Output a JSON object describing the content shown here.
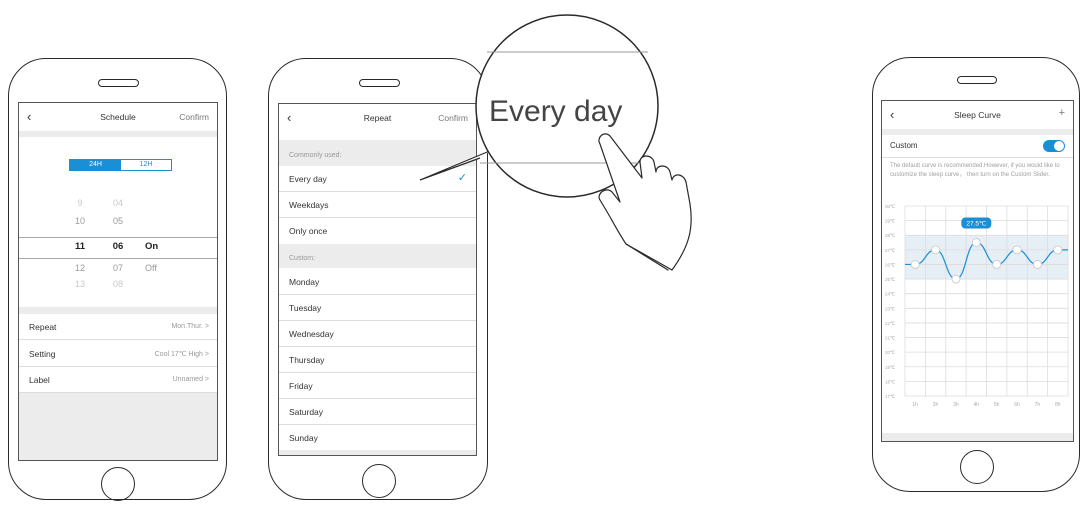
{
  "accent": "#1a8fd6",
  "phone1": {
    "back_icon": "chevron-left-icon",
    "title": "Schedule",
    "confirm": "Confirm",
    "format_24": "24H",
    "format_12": "12H",
    "hours": [
      "9",
      "10",
      "11",
      "12",
      "13"
    ],
    "minutes": [
      "04",
      "05",
      "06",
      "07",
      "08"
    ],
    "modes": [
      "On",
      "Off"
    ],
    "rows": [
      {
        "label": "Repeat",
        "value": "Mon.Thur. >"
      },
      {
        "label": "Setting",
        "value": "Cool 17℃ High >"
      },
      {
        "label": "Label",
        "value": "Unnamed >"
      }
    ]
  },
  "phone2": {
    "title": "Repeat",
    "confirm": "Confirm",
    "common_header": "Commonly used:",
    "common_items": [
      "Every day",
      "Weekdays",
      "Only once"
    ],
    "custom_header": "Custom:",
    "custom_items": [
      "Monday",
      "Tuesday",
      "Wednesday",
      "Thursday",
      "Friday",
      "Saturday",
      "Sunday"
    ],
    "selected_icon": "checkmark-icon"
  },
  "zoom": {
    "text": "Every day",
    "hand_icon": "pointing-hand-icon"
  },
  "phone3": {
    "title": "Sleep Curve",
    "add": "+",
    "custom_label": "Custom",
    "toggle_on": true,
    "description": "The default curve is recommended.However, if you would like to customize the sleep curve， then turn on the Custom Slider.",
    "tooltip": "27.5℃",
    "chart_data": {
      "type": "line",
      "x": [
        "1h",
        "2h",
        "3h",
        "4h",
        "5h",
        "6h",
        "7h",
        "8h"
      ],
      "y_ticks": [
        "30℃",
        "29℃",
        "28℃",
        "27℃",
        "26℃",
        "25℃",
        "24℃",
        "23℃",
        "22℃",
        "21℃",
        "20℃",
        "19℃",
        "18℃",
        "17℃"
      ],
      "ylim": [
        17,
        30
      ],
      "control_points": [
        {
          "x": 0.5,
          "y": 26
        },
        {
          "x": 1.5,
          "y": 27
        },
        {
          "x": 2.5,
          "y": 25
        },
        {
          "x": 3.5,
          "y": 27.5
        },
        {
          "x": 4.5,
          "y": 26
        },
        {
          "x": 5.5,
          "y": 27
        },
        {
          "x": 6.5,
          "y": 26
        },
        {
          "x": 7.5,
          "y": 27
        }
      ],
      "band": [
        25,
        28
      ],
      "grid": true
    }
  }
}
